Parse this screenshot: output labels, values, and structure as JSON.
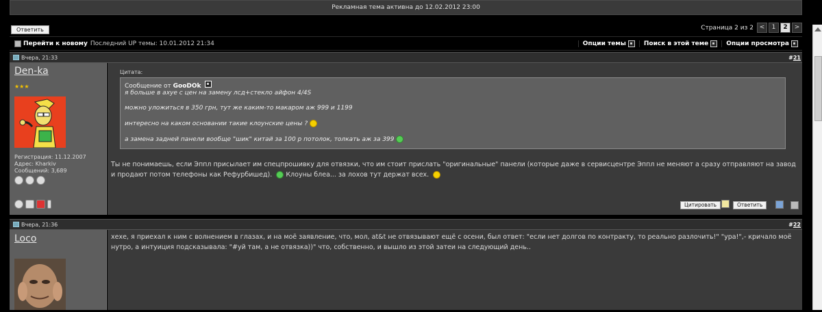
{
  "ad_bar": "Рекламная тема активна до 12.02.2012 23:00",
  "reply_top_label": "Ответить",
  "pager": {
    "label": "Страница 2 из 2",
    "prev": "<",
    "pages": [
      "1",
      "2"
    ],
    "next": ">"
  },
  "toolbar": {
    "new_label": "Перейти к новому",
    "last_up": "Последний UP темы: 10.01.2012 21:34",
    "options": [
      "Опции темы",
      "Поиск в этой теме",
      "Опции просмотра"
    ]
  },
  "posts": [
    {
      "date": "Вчера, 21:33",
      "num_prefix": "#",
      "num": "21",
      "username": "Den-ka",
      "stars": "★★★",
      "reg": "Регистрация: 11.12.2007",
      "addr": "Адрес: Kharkiv",
      "msgs": "Сообщений: 3,689",
      "quote_label": "Цитата:",
      "quote_from_prefix": "Сообщение от",
      "quote_from": "GooDOk",
      "quote_lines": [
        "я больше в ахуе с цен на замену лсд+стекло айфон 4/4S",
        "можно уложиться в 350 грн, тут же каким-то макаром аж 999 и 1199",
        "интересно на каком основании такие клоунские цены ?",
        "а замена задней панели вообще \"шик\" китай за 100 р потолок, толкать аж за 399"
      ],
      "message": "Ты не понимаешь, если Эппл присылает им спецпрошивку для отвязки, что им стоит прислать \"оригинальные\" панели (которые даже в сервисцентре Эппл не меняют а сразу отправляют на завод и продают потом телефоны как Рефурбишед).",
      "message_tail": "Клоуны блеа... за лохов тут держат всех.",
      "quote_btn": "Цитировать",
      "reply_btn": "Ответить"
    },
    {
      "date": "Вчера, 21:36",
      "num_prefix": "#",
      "num": "22",
      "username": "Loco",
      "message": "хехе, я приехал к ним с волнением в глазах, и на моё заявление, что, мол, at&t не отвязывают ещё с осени, был ответ: \"если нет долгов по контракту, то реально разлочить!\" \"ура!\",- кричало моё нутро, а интуиция подсказывала: \"#уй там, а не отвязка))\" что, собственно, и вышло из этой затеи на следующий день.."
    }
  ]
}
